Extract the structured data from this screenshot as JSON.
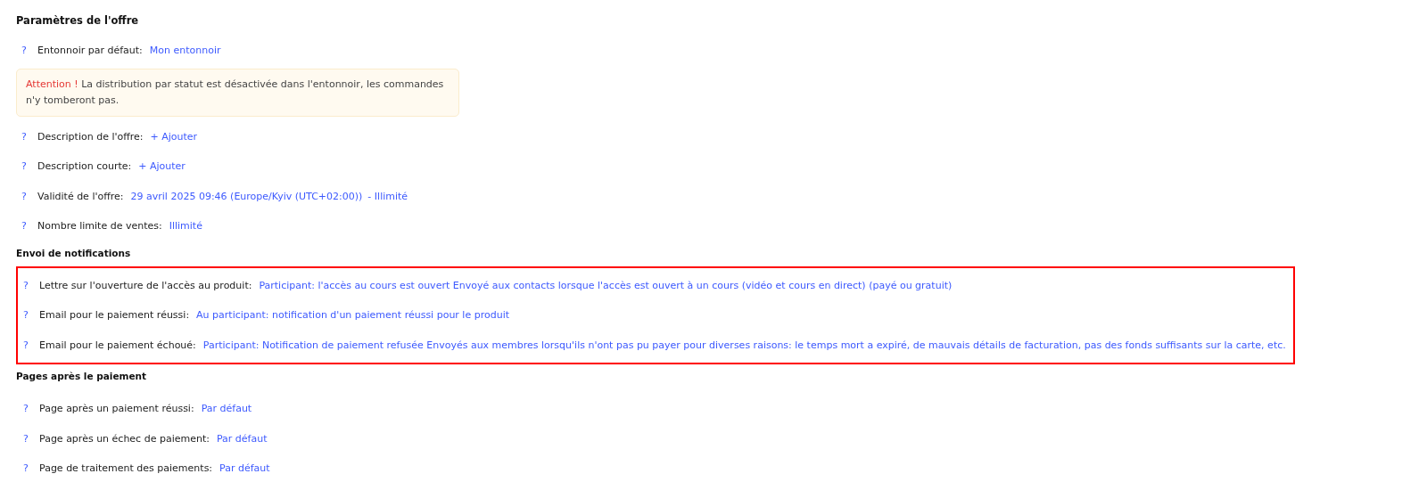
{
  "title": "Paramètres de l'offre",
  "settings": [
    {
      "help": "?",
      "label": "Entonnoir par défaut:",
      "values": [
        "Mon entonnoir"
      ]
    }
  ],
  "alert": {
    "prefix": "Attention !",
    "text": "La distribution par statut est désactivée dans l'entonnoir, les commandes n'y tomberont pas."
  },
  "settings_2": [
    {
      "help": "?",
      "label": "Description de l'offre:",
      "values": [
        "+ Ajouter"
      ]
    },
    {
      "help": "?",
      "label": "Description courte:",
      "values": [
        "+ Ajouter"
      ]
    },
    {
      "help": "?",
      "label": "Validité de l'offre:",
      "values": [
        "29 avril 2025 09:46 (Europe/Kyiv (UTC+02:00))",
        "- Illimité"
      ]
    },
    {
      "help": "?",
      "label": "Nombre limite de ventes:",
      "values": [
        "Illimité"
      ]
    }
  ],
  "sections": [
    {
      "title": "Envoi de notifications",
      "highlighted": true,
      "rows": [
        {
          "help": "?",
          "label": "Lettre sur l'ouverture de l'accès au produit:",
          "values": [
            "Participant: l'accès au cours est ouvert Envoyé aux contacts lorsque l'accès est ouvert à un cours (vidéo et cours en direct) (payé ou gratuit)"
          ]
        },
        {
          "help": "?",
          "label": "Email pour le paiement réussi:",
          "values": [
            "Au participant: notification d'un paiement réussi pour le produit"
          ]
        },
        {
          "help": "?",
          "label": "Email pour le paiement échoué:",
          "values": [
            "Participant: Notification de paiement refusée Envoyés aux membres lorsqu'ils n'ont pas pu payer pour diverses raisons: le temps mort a expiré, de mauvais détails de facturation, pas des fonds suffisants sur la carte, etc."
          ]
        }
      ]
    },
    {
      "title": "Pages après le paiement",
      "highlighted": false,
      "rows": [
        {
          "help": "?",
          "label": "Page après un paiement réussi:",
          "values": [
            "Par défaut"
          ]
        },
        {
          "help": "?",
          "label": "Page après un échec de paiement:",
          "values": [
            "Par défaut"
          ]
        },
        {
          "help": "?",
          "label": "Page de traitement des paiements:",
          "values": [
            "Par défaut"
          ]
        }
      ]
    }
  ]
}
